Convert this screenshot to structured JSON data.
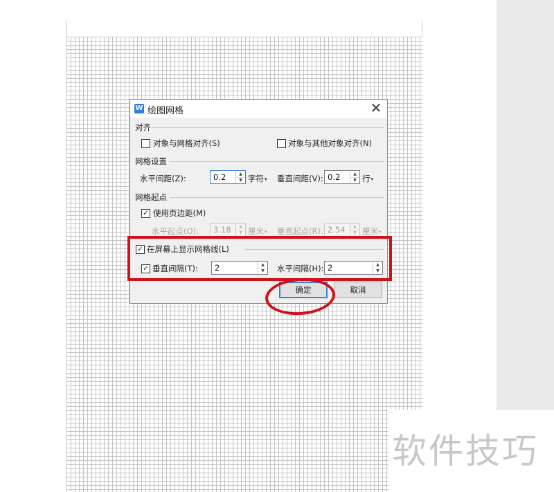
{
  "watermark": "软件技巧",
  "dialog": {
    "title": "绘图网格",
    "close_glyph": "✕",
    "app_icon": "wps-writer-icon",
    "align": {
      "section_label": "对齐",
      "snap_to_grid": {
        "label": "对象与网格对齐(S)",
        "checked": false
      },
      "snap_to_objects": {
        "label": "对象与其他对象对齐(N)",
        "checked": false
      }
    },
    "grid_settings": {
      "section_label": "网格设置",
      "horizontal_spacing": {
        "label": "水平间距(Z):",
        "value": "0.2",
        "unit": "字符"
      },
      "vertical_spacing": {
        "label": "垂直间距(V):",
        "value": "0.2",
        "unit": "行"
      }
    },
    "grid_origin": {
      "section_label": "网格起点",
      "use_margins": {
        "label": "使用页边距(M)",
        "checked": true
      },
      "horizontal_origin": {
        "label": "水平起点(O):",
        "value": "3.18",
        "unit": "厘米"
      },
      "vertical_origin": {
        "label": "垂直起点(R):",
        "value": "2.54",
        "unit": "厘米"
      }
    },
    "display": {
      "show_gridlines": {
        "label": "在屏幕上显示网格线(L)",
        "checked": true
      },
      "vertical_every": {
        "label": "垂直间隔(T):",
        "value": "2",
        "checked": true
      },
      "horizontal_every": {
        "label": "水平间隔(H):",
        "value": "2"
      }
    },
    "ok_label": "确定",
    "cancel_label": "取消"
  },
  "glyphs": {
    "check": "✓",
    "up": "▲",
    "down": "▼",
    "caret": "▾"
  },
  "colors": {
    "highlight": "#d0101a",
    "accent": "#3c7fd6"
  }
}
